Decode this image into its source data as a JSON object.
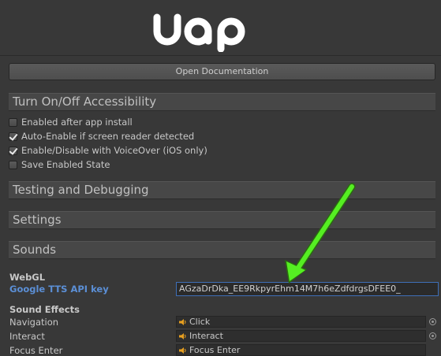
{
  "logo": {
    "text": "uap"
  },
  "doc_button": {
    "label": "Open Documentation"
  },
  "sections": {
    "accessibility": "Turn On/Off Accessibility",
    "testing": "Testing and Debugging",
    "settings": "Settings",
    "sounds": "Sounds"
  },
  "checkboxes": [
    {
      "label": "Enabled after app install",
      "checked": false
    },
    {
      "label": "Auto-Enable if screen reader detected",
      "checked": true
    },
    {
      "label": "Enable/Disable with VoiceOver (iOS only)",
      "checked": true
    },
    {
      "label": "Save Enabled State",
      "checked": false
    }
  ],
  "webgl": {
    "header": "WebGL",
    "api_key_label": "Google TTS API key",
    "api_key_value": "AGzaDrDka_EE9RkpyrEhm14M7h6eZdfdrgsDFEE0_"
  },
  "sound_effects": {
    "header": "Sound Effects",
    "rows": [
      {
        "label": "Navigation",
        "value": "Click"
      },
      {
        "label": "Interact",
        "value": "Interact"
      },
      {
        "label": "Focus Enter",
        "value": "Focus Enter"
      }
    ]
  },
  "colors": {
    "arrow": "#55ee22",
    "link_label": "#5b8fd6",
    "field_focus": "#3e6fb8"
  }
}
